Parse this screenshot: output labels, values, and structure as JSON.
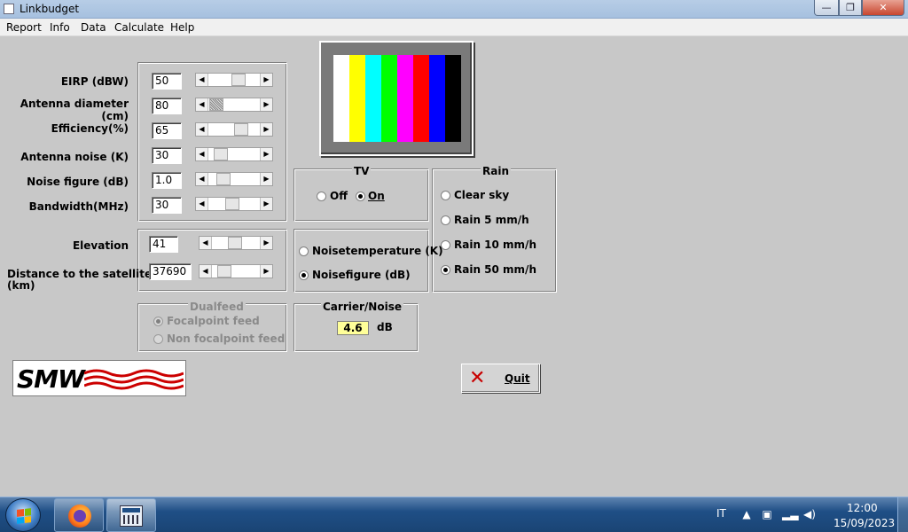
{
  "window": {
    "title": "Linkbudget",
    "minimize": "—",
    "maximize": "❐",
    "close": "✕"
  },
  "menu": [
    "Report",
    "Info",
    "Data",
    "Calculate",
    "Help"
  ],
  "params": {
    "eirp": {
      "label": "EIRP (dBW)",
      "value": "50"
    },
    "antenna_diameter": {
      "label": "Antenna diameter (cm)",
      "value": "80"
    },
    "efficiency": {
      "label": "Efficiency(%)",
      "value": "65"
    },
    "antenna_noise": {
      "label": "Antenna noise (K)",
      "value": "30"
    },
    "noise_figure": {
      "label": "Noise figure (dB)",
      "value": "1.0"
    },
    "bandwidth": {
      "label": "Bandwidth(MHz)",
      "value": "30"
    },
    "elevation": {
      "label": "Elevation",
      "value": "41"
    },
    "distance": {
      "label_line1": "Distance to the satellite",
      "label_line2": "(km)",
      "value": "37690"
    }
  },
  "tv": {
    "title": "TV",
    "off": "Off",
    "on": "On",
    "selected": "On",
    "bar_colors": [
      "#ffffff",
      "#ffff00",
      "#00ffff",
      "#00ff00",
      "#ff00ff",
      "#ff0000",
      "#0000ff",
      "#000000"
    ]
  },
  "rain": {
    "title": "Rain",
    "options": [
      "Clear sky",
      "Rain 5 mm/h",
      "Rain 10 mm/h",
      "Rain 50 mm/h"
    ],
    "selected": "Rain 50 mm/h"
  },
  "noise_mode": {
    "options": [
      "Noisetemperature (K)",
      "Noisefigure (dB)"
    ],
    "selected": "Noisefigure (dB)"
  },
  "dualfeed": {
    "title": "Dualfeed",
    "options": [
      "Focalpoint feed",
      "Non focalpoint feed"
    ],
    "selected": "Focalpoint feed",
    "enabled": false
  },
  "carrier_noise": {
    "title": "Carrier/Noise",
    "value": "4.6",
    "unit": "dB"
  },
  "logo": {
    "text": "SMW"
  },
  "quit": {
    "label": "Quit"
  },
  "taskbar": {
    "language": "IT",
    "time": "12:00",
    "date": "15/09/2023"
  }
}
